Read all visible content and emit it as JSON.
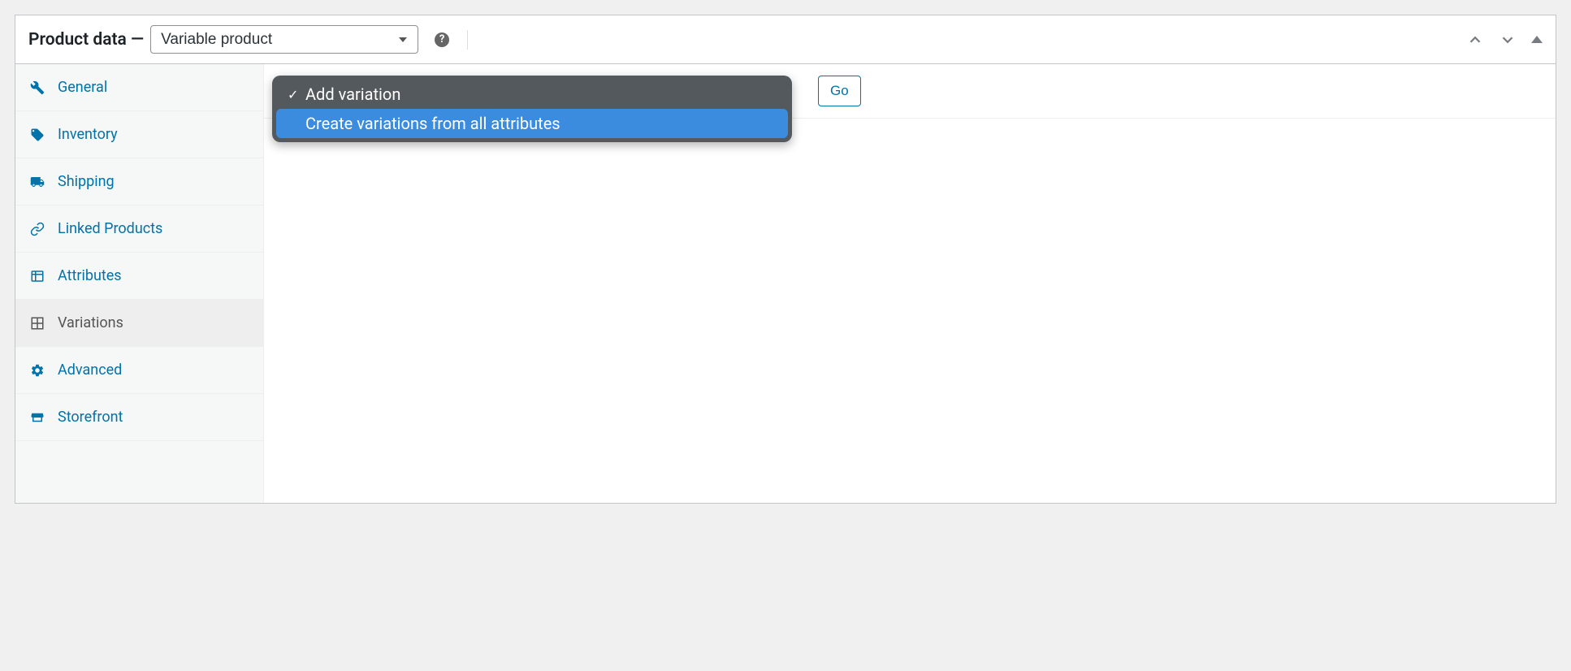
{
  "header": {
    "title": "Product data —",
    "product_type": "Variable product"
  },
  "sidebar": {
    "items": [
      {
        "label": "General",
        "icon": "wrench"
      },
      {
        "label": "Inventory",
        "icon": "tag"
      },
      {
        "label": "Shipping",
        "icon": "truck"
      },
      {
        "label": "Linked Products",
        "icon": "link"
      },
      {
        "label": "Attributes",
        "icon": "list"
      },
      {
        "label": "Variations",
        "icon": "grid",
        "active": true
      },
      {
        "label": "Advanced",
        "icon": "gear"
      },
      {
        "label": "Storefront",
        "icon": "storefront"
      }
    ]
  },
  "toolbar": {
    "go_label": "Go"
  },
  "dropdown": {
    "options": [
      {
        "label": "Add variation",
        "selected": true
      },
      {
        "label": "Create variations from all attributes",
        "highlighted": true
      }
    ]
  }
}
